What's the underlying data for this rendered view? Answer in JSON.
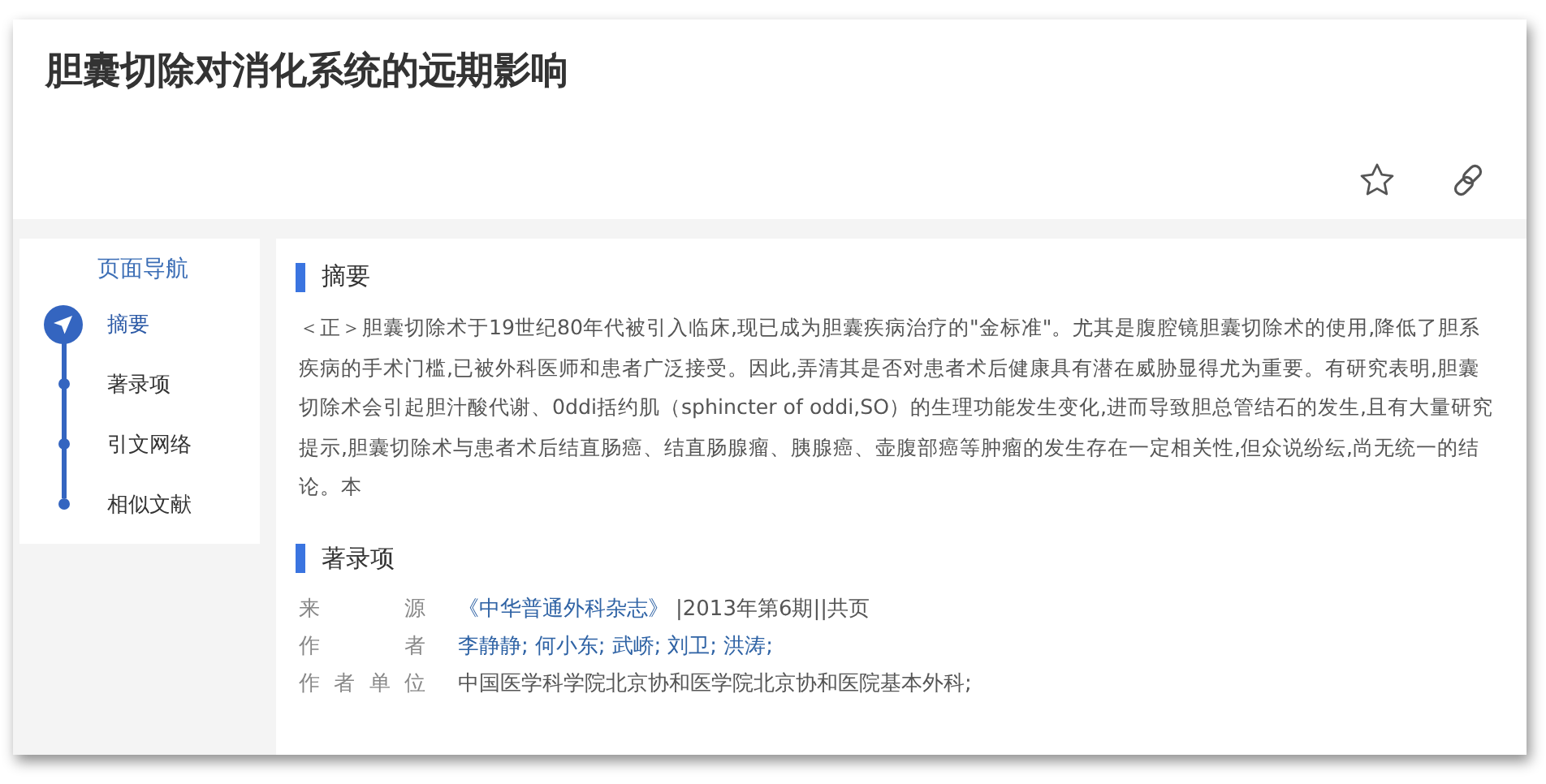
{
  "header": {
    "title": "胆囊切除对消化系统的远期影响"
  },
  "nav": {
    "title": "页面导航",
    "items": [
      {
        "label": "摘要",
        "selected": true
      },
      {
        "label": "著录项",
        "selected": false
      },
      {
        "label": "引文网络",
        "selected": false
      },
      {
        "label": "相似文献",
        "selected": false
      }
    ]
  },
  "abstract": {
    "heading": "摘要",
    "text": "＜正＞胆囊切除术于19世纪80年代被引入临床,现已成为胆囊疾病治疗的\"金标准\"。尤其是腹腔镜胆囊切除术的使用,降低了胆系疾病的手术门槛,已被外科医师和患者广泛接受。因此,弄清其是否对患者术后健康具有潜在威胁显得尤为重要。有研究表明,胆囊切除术会引起胆汁酸代谢、0ddi括约肌（sphincter of oddi,SO）的生理功能发生变化,进而导致胆总管结石的发生,且有大量研究提示,胆囊切除术与患者术后结直肠癌、结直肠腺瘤、胰腺癌、壶腹部癌等肿瘤的发生存在一定相关性,但众说纷纭,尚无统一的结论。本"
  },
  "record": {
    "heading": "著录项",
    "fields": [
      {
        "label": "来 源",
        "links": [
          "《中华普通外科杂志》"
        ],
        "text": "|2013年第6期||共页"
      },
      {
        "label": "作 者",
        "links": [
          "李静静;",
          "何小东;",
          "武峤;",
          "刘卫;",
          "洪涛;"
        ]
      },
      {
        "label": "作 者 单 位",
        "text": "中国医学科学院北京协和医学院北京协和医院基本外科;"
      }
    ]
  }
}
